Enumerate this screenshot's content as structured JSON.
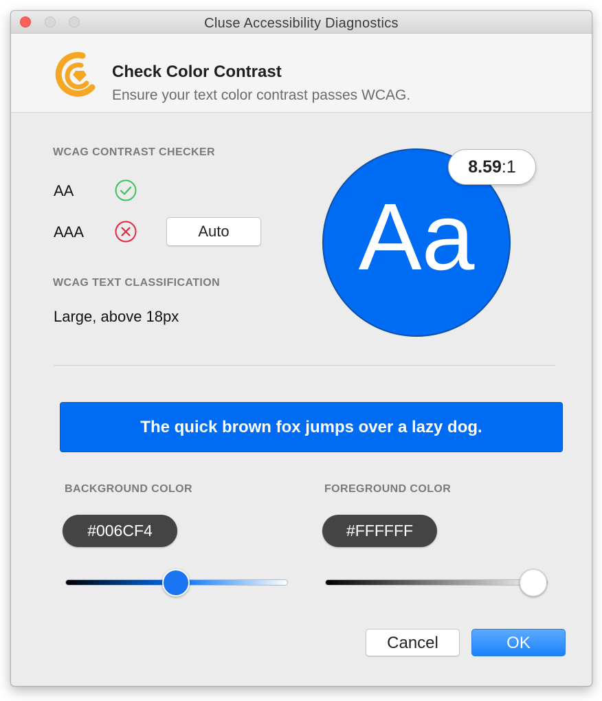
{
  "window": {
    "title": "Cluse Accessibility Diagnostics"
  },
  "header": {
    "logo_icon": "cluse-logo-icon",
    "title": "Check Color Contrast",
    "subtitle": "Ensure your text color contrast passes WCAG."
  },
  "checker": {
    "section_label": "WCAG CONTRAST CHECKER",
    "levels": [
      {
        "label": "AA",
        "status": "pass",
        "icon": "check-circle-icon",
        "color": "#3cc25a"
      },
      {
        "label": "AAA",
        "status": "fail",
        "icon": "x-circle-icon",
        "color": "#e8253f"
      }
    ],
    "auto_button_label": "Auto"
  },
  "classification": {
    "section_label": "WCAG TEXT CLASSIFICATION",
    "value": "Large, above 18px"
  },
  "preview": {
    "text": "Aa",
    "ratio_value": "8.59",
    "ratio_suffix": ":1",
    "background": "#006CF4",
    "foreground": "#FFFFFF"
  },
  "sample": {
    "text": "The quick brown fox jumps over a lazy dog."
  },
  "background_color": {
    "label": "BACKGROUND COLOR",
    "hex": "#006CF4",
    "slider_value": 0.5
  },
  "foreground_color": {
    "label": "FOREGROUND COLOR",
    "hex": "#FFFFFF",
    "slider_value": 1.0
  },
  "buttons": {
    "cancel_label": "Cancel",
    "ok_label": "OK"
  },
  "colors": {
    "accent": "#006CF4",
    "ok_button": "#1A82FB",
    "logo_orange": "#F5A623",
    "close_button": "#FC605C"
  }
}
